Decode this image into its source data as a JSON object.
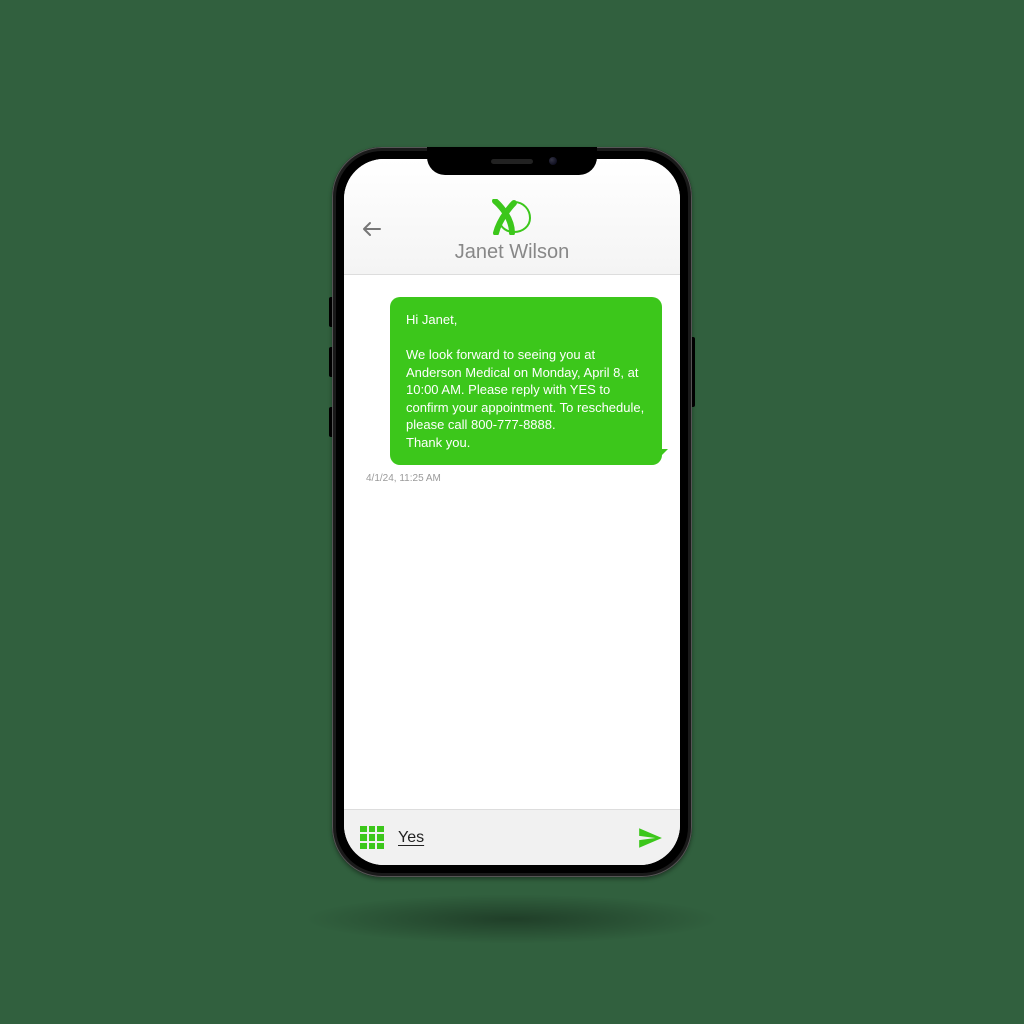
{
  "colors": {
    "brand_green": "#3cc71b",
    "page_bg": "#31603e"
  },
  "header": {
    "contact_name": "Janet Wilson",
    "logo_name": "app-logo"
  },
  "conversation": {
    "messages": [
      {
        "direction": "outgoing",
        "text": "Hi Janet,\n\nWe look forward to seeing you at Anderson Medical on Monday, April 8, at 10:00 AM. Please reply with YES to confirm your appoint­ment. To reschedule, please call 800-777-8888.\nThank you.",
        "timestamp": "4/1/24, 11:25 AM"
      }
    ]
  },
  "compose": {
    "input_value": "Yes"
  }
}
